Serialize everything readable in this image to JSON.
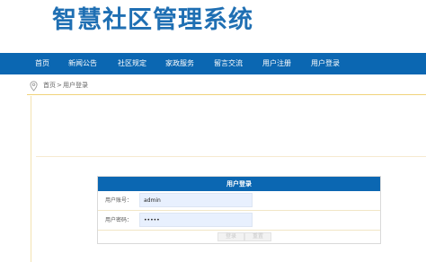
{
  "header": {
    "site_title": "智慧社区管理系统"
  },
  "nav": {
    "items": [
      {
        "label": "首页"
      },
      {
        "label": "新闻公告"
      },
      {
        "label": "社区规定"
      },
      {
        "label": "家政服务"
      },
      {
        "label": "留言交流"
      },
      {
        "label": "用户注册"
      },
      {
        "label": "用户登录"
      }
    ]
  },
  "breadcrumb": {
    "icon": "location-pin-icon",
    "home": "首页",
    "separator": ">",
    "current": "用户登录"
  },
  "login": {
    "title": "用户登录",
    "username_label": "用户账号：",
    "username_value": "admin",
    "password_label": "用户密码：",
    "password_value": "admin",
    "submit_label": "登录",
    "reset_label": "重置"
  },
  "colors": {
    "brand": "#0b67b2",
    "title": "#1f6fb3",
    "input_bg": "#e8f0fe",
    "divider": "#f1d37b"
  }
}
